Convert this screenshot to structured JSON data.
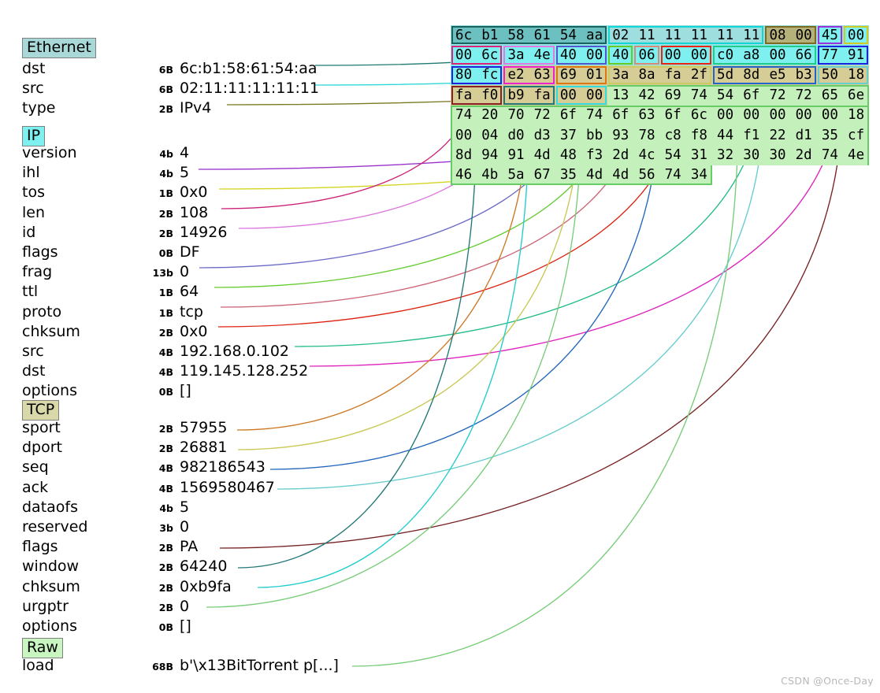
{
  "title": "Scapy packet dissection diagram",
  "watermark": "CSDN @Once-Day",
  "layers": [
    {
      "name": "Ethernet",
      "label_bg": "#a8d8d8",
      "fields": [
        {
          "name": "dst",
          "size": "6B",
          "value": "6c:b1:58:61:54:aa"
        },
        {
          "name": "src",
          "size": "6B",
          "value": "02:11:11:11:11:11"
        },
        {
          "name": "type",
          "size": "2B",
          "value": "IPv4"
        }
      ]
    },
    {
      "name": "IP",
      "label_bg": "#7ff0f0",
      "fields": [
        {
          "name": "version",
          "size": "4b",
          "value": "4"
        },
        {
          "name": "ihl",
          "size": "4b",
          "value": "5"
        },
        {
          "name": "tos",
          "size": "1B",
          "value": "0x0"
        },
        {
          "name": "len",
          "size": "2B",
          "value": "108"
        },
        {
          "name": "id",
          "size": "2B",
          "value": "14926"
        },
        {
          "name": "flags",
          "size": "0B",
          "value": "DF"
        },
        {
          "name": "frag",
          "size": "13b",
          "value": "0"
        },
        {
          "name": "ttl",
          "size": "1B",
          "value": "64"
        },
        {
          "name": "proto",
          "size": "1B",
          "value": "tcp"
        },
        {
          "name": "chksum",
          "size": "2B",
          "value": "0x0"
        },
        {
          "name": "src",
          "size": "4B",
          "value": "192.168.0.102"
        },
        {
          "name": "dst",
          "size": "4B",
          "value": "119.145.128.252"
        },
        {
          "name": "options",
          "size": "0B",
          "value": "[]"
        }
      ]
    },
    {
      "name": "TCP",
      "label_bg": "#d8d8a8",
      "fields": [
        {
          "name": "sport",
          "size": "2B",
          "value": "57955"
        },
        {
          "name": "dport",
          "size": "2B",
          "value": "26881"
        },
        {
          "name": "seq",
          "size": "4B",
          "value": "982186543"
        },
        {
          "name": "ack",
          "size": "4B",
          "value": "1569580467"
        },
        {
          "name": "dataofs",
          "size": "4b",
          "value": "5"
        },
        {
          "name": "reserved",
          "size": "3b",
          "value": "0"
        },
        {
          "name": "flags",
          "size": "2B",
          "value": "PA"
        },
        {
          "name": "window",
          "size": "2B",
          "value": "64240"
        },
        {
          "name": "chksum",
          "size": "2B",
          "value": "0xb9fa"
        },
        {
          "name": "urgptr",
          "size": "2B",
          "value": "0"
        },
        {
          "name": "options",
          "size": "0B",
          "value": "[]"
        }
      ]
    },
    {
      "name": "Raw",
      "label_bg": "#c8f5c0",
      "fields": [
        {
          "name": "load",
          "size": "68B",
          "value": "b'\\x13BitTorrent p[...]"
        }
      ]
    }
  ],
  "hexdump": {
    "bytes_per_row": 16,
    "rows": [
      [
        "6c",
        "b1",
        "58",
        "61",
        "54",
        "aa",
        "02",
        "11",
        "11",
        "11",
        "11",
        "11",
        "08",
        "00",
        "45",
        "00"
      ],
      [
        "00",
        "6c",
        "3a",
        "4e",
        "40",
        "00",
        "40",
        "06",
        "00",
        "00",
        "c0",
        "a8",
        "00",
        "66",
        "77",
        "91"
      ],
      [
        "80",
        "fc",
        "e2",
        "63",
        "69",
        "01",
        "3a",
        "8a",
        "fa",
        "2f",
        "5d",
        "8d",
        "e5",
        "b3",
        "50",
        "18"
      ],
      [
        "fa",
        "f0",
        "b9",
        "fa",
        "00",
        "00",
        "13",
        "42",
        "69",
        "74",
        "54",
        "6f",
        "72",
        "72",
        "65",
        "6e"
      ],
      [
        "74",
        "20",
        "70",
        "72",
        "6f",
        "74",
        "6f",
        "63",
        "6f",
        "6c",
        "00",
        "00",
        "00",
        "00",
        "00",
        "18"
      ],
      [
        "00",
        "04",
        "d0",
        "d3",
        "37",
        "bb",
        "93",
        "78",
        "c8",
        "f8",
        "44",
        "f1",
        "22",
        "d1",
        "35",
        "cf"
      ],
      [
        "8d",
        "94",
        "91",
        "4d",
        "48",
        "f3",
        "2d",
        "4c",
        "54",
        "31",
        "32",
        "30",
        "30",
        "2d",
        "74",
        "4e"
      ],
      [
        "46",
        "4b",
        "5a",
        "67",
        "35",
        "4d",
        "4d",
        "56",
        "74",
        "34"
      ]
    ],
    "backgrounds": [
      {
        "name": "ethernet-ip-bg",
        "row": 0,
        "col": 0,
        "span": 16,
        "rows": 1,
        "color": "#9fdede"
      },
      {
        "name": "ip-bg-row2",
        "row": 1,
        "col": 0,
        "span": 16,
        "rows": 1,
        "color": "#7ef0f0"
      },
      {
        "name": "ip-tcp-bg-row3",
        "row": 2,
        "col": 0,
        "span": 2,
        "rows": 1,
        "color": "#7ef0f0"
      },
      {
        "name": "tcp-bg-row3",
        "row": 2,
        "col": 2,
        "span": 14,
        "rows": 1,
        "color": "#d6cc96"
      },
      {
        "name": "tcp-bg-row4",
        "row": 3,
        "col": 0,
        "span": 6,
        "rows": 1,
        "color": "#d6cc96"
      },
      {
        "name": "raw-bg",
        "row": 3,
        "col": 6,
        "span": 10,
        "rows": 1,
        "color": "#c4f0bc"
      },
      {
        "name": "raw-bg-rows",
        "row": 4,
        "col": 0,
        "span": 16,
        "rows": 3,
        "color": "#c4f0bc"
      },
      {
        "name": "raw-bg-last",
        "row": 7,
        "col": 0,
        "span": 10,
        "rows": 1,
        "color": "#c4f0bc"
      }
    ],
    "cells": [
      {
        "field": "eth-dst",
        "row": 0,
        "col": 0,
        "span": 6,
        "bg": "#6cc0c0",
        "border": "#17635e"
      },
      {
        "field": "eth-src",
        "row": 0,
        "col": 6,
        "span": 6,
        "bg": "#9fdede",
        "border": "#12d6d6"
      },
      {
        "field": "eth-type",
        "row": 0,
        "col": 12,
        "span": 2,
        "bg": "#b6b07a",
        "border": "#7a6b1e"
      },
      {
        "field": "ip-ver-ihl",
        "row": 0,
        "col": 14,
        "span": 1,
        "bg": "#7ef0f0",
        "border": "#9933dd"
      },
      {
        "field": "ip-tos",
        "row": 0,
        "col": 15,
        "span": 1,
        "bg": "#7ef0f0",
        "border": "#cccc22"
      },
      {
        "field": "ip-len",
        "row": 1,
        "col": 0,
        "span": 2,
        "bg": "#7ef0f0",
        "border": "#dd2277"
      },
      {
        "field": "ip-id",
        "row": 1,
        "col": 2,
        "span": 2,
        "bg": "#7ef0f0",
        "border": "#e07ce0"
      },
      {
        "field": "ip-flagfrag",
        "row": 1,
        "col": 4,
        "span": 2,
        "bg": "#7ef0f0",
        "border": "#5555cc"
      },
      {
        "field": "ip-ttl",
        "row": 1,
        "col": 6,
        "span": 1,
        "bg": "#7ef0f0",
        "border": "#66cc22"
      },
      {
        "field": "ip-proto",
        "row": 1,
        "col": 7,
        "span": 1,
        "bg": "#7ef0f0",
        "border": "#dd8877"
      },
      {
        "field": "ip-chksum",
        "row": 1,
        "col": 8,
        "span": 2,
        "bg": "#7ef0f0",
        "border": "#ee2211"
      },
      {
        "field": "ip-src",
        "row": 1,
        "col": 10,
        "span": 4,
        "bg": "#7ef0f0",
        "border": "#22cc88"
      },
      {
        "field": "ip-dst",
        "row": 1,
        "col": 14,
        "span": 2,
        "bg": "#7ef0f0",
        "border": "#2222dd"
      },
      {
        "field": "ip-dst-cont",
        "row": 2,
        "col": 0,
        "span": 2,
        "bg": "#7ef0f0",
        "border": "#2222dd"
      },
      {
        "field": "tcp-sport",
        "row": 2,
        "col": 2,
        "span": 2,
        "bg": "#d6cc96",
        "border": "#ee22cc"
      },
      {
        "field": "tcp-dport",
        "row": 2,
        "col": 4,
        "span": 2,
        "bg": "#d6cc96",
        "border": "#dd7711"
      },
      {
        "field": "tcp-seq",
        "row": 2,
        "col": 6,
        "span": 4,
        "bg": "#d6cc96",
        "border": "#cccc66"
      },
      {
        "field": "tcp-ack",
        "row": 2,
        "col": 10,
        "span": 4,
        "bg": "#d6cc96",
        "border": "#2266cc"
      },
      {
        "field": "tcp-flags",
        "row": 2,
        "col": 14,
        "span": 2,
        "bg": "#d6cc96",
        "border": "#66d0d0"
      },
      {
        "field": "tcp-window",
        "row": 3,
        "col": 0,
        "span": 2,
        "bg": "#d6cc96",
        "border": "#882222"
      },
      {
        "field": "tcp-chksum",
        "row": 3,
        "col": 2,
        "span": 2,
        "bg": "#d6cc96",
        "border": "#227777"
      },
      {
        "field": "tcp-urgptr",
        "row": 3,
        "col": 4,
        "span": 2,
        "bg": "#d6cc96",
        "border": "#33dddd"
      },
      {
        "field": "raw-load",
        "row": 3,
        "col": 6,
        "span": 10,
        "bg": "transparent",
        "border": "#66cc66"
      }
    ]
  },
  "connectors": [
    {
      "from": "eth-dst",
      "color": "#1f7a72"
    },
    {
      "from": "eth-src",
      "color": "#2fd8d8"
    },
    {
      "from": "eth-type",
      "color": "#7a7a22"
    },
    {
      "from": "ip-ihl",
      "color": "#9933cc"
    },
    {
      "from": "ip-tos",
      "color": "#d4d422"
    },
    {
      "from": "ip-len",
      "color": "#cc2277"
    },
    {
      "from": "ip-id",
      "color": "#dd77dd"
    },
    {
      "from": "ip-frag",
      "color": "#6a6ac8"
    },
    {
      "from": "ip-ttl",
      "color": "#66cc33"
    },
    {
      "from": "ip-proto",
      "color": "#cc6677"
    },
    {
      "from": "ip-chksum",
      "color": "#dd2211"
    },
    {
      "from": "ip-src",
      "color": "#22bb88"
    },
    {
      "from": "tcp-sport",
      "color": "#dd22bb"
    },
    {
      "from": "tcp-dport",
      "color": "#cc7722"
    },
    {
      "from": "tcp-seq",
      "color": "#c8c855"
    },
    {
      "from": "tcp-ack",
      "color": "#2266bb"
    },
    {
      "from": "tcp-flags",
      "color": "#66cccc"
    },
    {
      "from": "tcp-window",
      "color": "#772222"
    },
    {
      "from": "tcp-chksum",
      "color": "#227777"
    },
    {
      "from": "tcp-urgptr",
      "color": "#22cccc"
    },
    {
      "from": "raw-load",
      "color": "#77cc77"
    }
  ]
}
